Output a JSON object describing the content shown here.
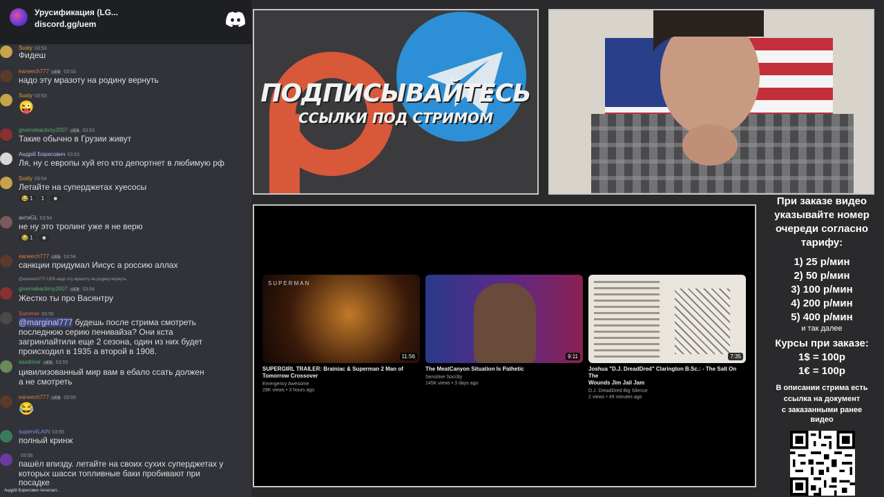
{
  "chat": {
    "server_name": "Урусификация (LG...",
    "invite": "discord.gg/uem",
    "messages": [
      {
        "user": "Susty",
        "user_color": "#e2a33a",
        "time": "03:53",
        "text": "Фидеш"
      },
      {
        "user": "eaneech777",
        "user_color": "#e07b3c",
        "tag": "UEB",
        "time": "03:53",
        "text": "надо эту мразоту на родину вернуть"
      },
      {
        "user": "Susty",
        "user_color": "#e2a33a",
        "time": "03:53",
        "emoji": "😜"
      },
      {
        "user": "givemebackmy2007",
        "user_color": "#4fb36b",
        "tag": "UEB",
        "time": "03:53",
        "text": "Такие обычно в Грузии живут"
      },
      {
        "user": "Андрій Борисович",
        "user_color": "#a9c4f0",
        "time": "03:53",
        "text": "Ля, ну с европы хуй его кто депортнет в любимую рф"
      },
      {
        "user": "Susty",
        "user_color": "#e2a33a",
        "time": "03:54",
        "text": "Летайте на суперджетах хуесосы",
        "reactions": [
          "😂 1",
          "1",
          "☻"
        ]
      },
      {
        "user": "антиGL",
        "user_color": "#b9bbbe",
        "time": "03:54",
        "text": "не ну это тролинг уже я не верю",
        "reactions": [
          "😂 1",
          "☻"
        ]
      },
      {
        "user": "eaneech777",
        "user_color": "#e07b3c",
        "tag": "UEB",
        "time": "03:54",
        "text": "санкции придумал Иисус а россию аллах"
      },
      {
        "reply": "@eaneech777 UEB надо эту мразоту на родину вернуть",
        "user": "givemebackmy2007",
        "user_color": "#4fb36b",
        "tag": "UEB",
        "time": "03:54",
        "text": "Жестко ты про Васянтру"
      },
      {
        "user": "Summer",
        "user_color": "#e85b5b",
        "time": "03:55",
        "mention": "@marginal777",
        "text1": " будешь после стрима смотреть",
        "text2": "последнюю серию пенивайза? Они кста",
        "text3": "загринлайтили еще 2 сезона, один из них будет",
        "text4": "происходил в 1935 а второй в 1908."
      },
      {
        "user": "assdriver",
        "user_color": "#4fb36b",
        "tag": "UEB",
        "time": "03:55",
        "text1": "цивилизованный мир вам в ебало ссать должен",
        "text2": "а не смотреть"
      },
      {
        "user": "eaneech777",
        "user_color": "#e07b3c",
        "tag": "UEB",
        "time": "03:55",
        "emoji": "😂"
      },
      {
        "user": "supervilLAIN",
        "user_color": "#7b8cf7",
        "time": "03:55",
        "text": "полный кринж"
      },
      {
        "user": "",
        "user_color": "#b9bbbe",
        "time": "03:56",
        "text1": "пашёл впизду. летайте на своих сухих суперджетах у",
        "text2": "которых шасси топливные баки пробивают при",
        "text3": "посадке"
      }
    ],
    "typing": "Андрій Борисович печатает..."
  },
  "promo": {
    "line1": "ПОДПИСЫВАЙТЕСЬ",
    "line2": "ССЫЛКИ ПОД СТРИМОМ"
  },
  "videos": [
    {
      "thumb_label": "SUPERMAN",
      "duration": "11:56",
      "title1": "SUPERGIRL TRAILER: Brainiac & Superman 2 Man of",
      "title2": "Tomorrow Crossover",
      "channel": "Emergency Awesome",
      "stats": "29K views • 3 hours ago"
    },
    {
      "duration": "9:11",
      "title1": "The MeatCanyon Situation Is Pathetic",
      "title2": "",
      "channel": "Sensitive Soci3ty",
      "stats": "145K views • 3 days ago"
    },
    {
      "duration": "7:35",
      "title1": "Joshua \"D.J. DreadDred\" Clarington B.Sc.: - The Salt On The",
      "title2": "Wounds Jim Jail Jam",
      "channel": "D.J. DreadDred Big Silence",
      "stats": "2 views • 49 minutes ago"
    }
  ],
  "info": {
    "l1": "При заказе видео",
    "l2": "указывайте номер",
    "l3": "очереди согласно",
    "l4": "тарифу:",
    "t1": "1) 25 р/мин",
    "t2": "2) 50 р/мин",
    "t3": "3) 100 р/мин",
    "t4": "4) 200 р/мин",
    "t5": "5) 400 р/мин",
    "etc": "и так далее",
    "c0": "Курсы при заказе:",
    "c1": "1$ = 100р",
    "c2": "1€ = 100р",
    "d1": "В описании стрима есть",
    "d2": "ссылка на документ",
    "d3": "с заказанными ранее",
    "d4": "видео"
  },
  "colors": {
    "chat_bg": "#313338",
    "header_bg": "#1e1f22",
    "telegram": "#2d8fd5",
    "patreon": "#e05a3a"
  }
}
